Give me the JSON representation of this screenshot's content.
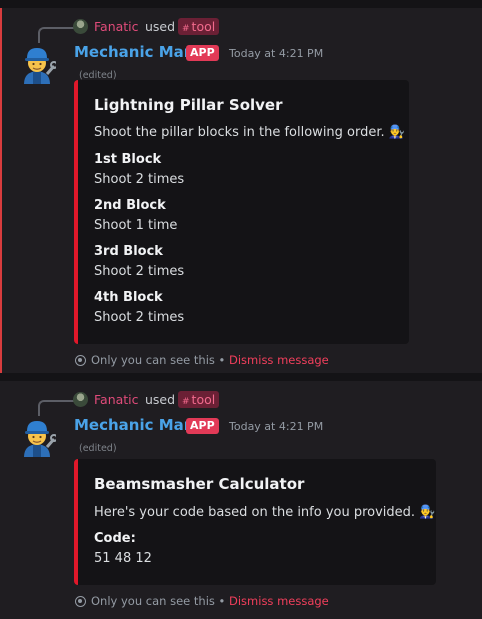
{
  "messages": [
    {
      "reply_user": "Fanatic",
      "reply_used": "used",
      "reply_command": "tool",
      "author": "Mechanic Man",
      "badge": "APP",
      "timestamp": "Today at 4:21 PM",
      "edited": "(edited)",
      "embed": {
        "title": "Lightning Pillar Solver",
        "description": "Shoot the pillar blocks in the following order. 👨‍🔧",
        "fields": [
          {
            "name": "1st Block",
            "value": "Shoot 2 times"
          },
          {
            "name": "2nd Block",
            "value": "Shoot 1 time"
          },
          {
            "name": "3rd Block",
            "value": "Shoot 2 times"
          },
          {
            "name": "4th Block",
            "value": "Shoot 2 times"
          }
        ],
        "accent_color": "#e0182a"
      },
      "ephemeral_note": "Only you can see this",
      "ephemeral_bullet": " • ",
      "dismiss": "Dismiss message"
    },
    {
      "reply_user": "Fanatic",
      "reply_used": "used",
      "reply_command": "tool",
      "author": "Mechanic Man",
      "badge": "APP",
      "timestamp": "Today at 4:21 PM",
      "edited": "(edited)",
      "embed": {
        "title": "Beamsmasher Calculator",
        "description": "Here's your code based on the info you provided. 👨‍🔧",
        "fields": [
          {
            "name": "Code:",
            "value": "51 48 12"
          }
        ],
        "accent_color": "#e0182a"
      },
      "ephemeral_note": "Only you can see this",
      "ephemeral_bullet": " • ",
      "dismiss": "Dismiss message"
    }
  ],
  "icons": {
    "hash": "#",
    "avatar": "mechanic-emoji-avatar",
    "eye": "eye-icon"
  },
  "colors": {
    "background": "#1f1d21",
    "author": "#4aa3e8",
    "app_badge": "#e23a57",
    "embed_border": "#e0182a",
    "dismiss": "#f23f5c"
  }
}
